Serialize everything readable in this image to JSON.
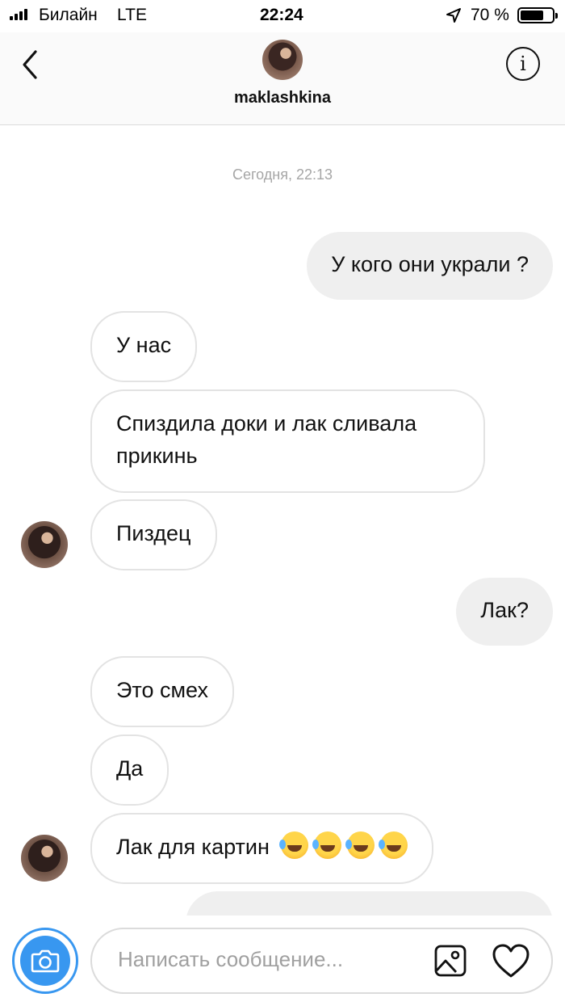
{
  "status_bar": {
    "carrier": "Билайн",
    "network": "LTE",
    "time": "22:24",
    "battery_percent": "70 %",
    "battery_level": 0.7,
    "signal_bars": 4
  },
  "header": {
    "username": "maklashkina",
    "back_icon": "chevron-left-icon",
    "info_icon": "info-icon",
    "info_glyph": "i"
  },
  "chat": {
    "date_separator": "Сегодня, 22:13",
    "messages": [
      {
        "direction": "outgoing",
        "text": "У кого они украли ?"
      },
      {
        "direction": "incoming",
        "text": "У нас"
      },
      {
        "direction": "incoming",
        "text": "Спиздила доки и лак сливала прикинь"
      },
      {
        "direction": "incoming",
        "text": "Пиздец",
        "show_avatar": true
      },
      {
        "direction": "outgoing",
        "text": "Лак?"
      },
      {
        "direction": "incoming",
        "text": "Это смех"
      },
      {
        "direction": "incoming",
        "text": "Да"
      },
      {
        "direction": "incoming",
        "text": "Лак для картин",
        "emoji_count": 4,
        "emoji": "rolling-on-floor-laughing",
        "show_avatar": true
      },
      {
        "direction": "outgoing",
        "text": ""
      }
    ]
  },
  "composer": {
    "placeholder": "Написать сообщение...",
    "camera_icon": "camera-icon",
    "gallery_icon": "image-icon",
    "like_icon": "heart-icon"
  },
  "colors": {
    "accent": "#3897f0",
    "outgoing_bubble": "#efefef",
    "incoming_border": "#e3e3e3",
    "header_bg": "#fafafa"
  }
}
